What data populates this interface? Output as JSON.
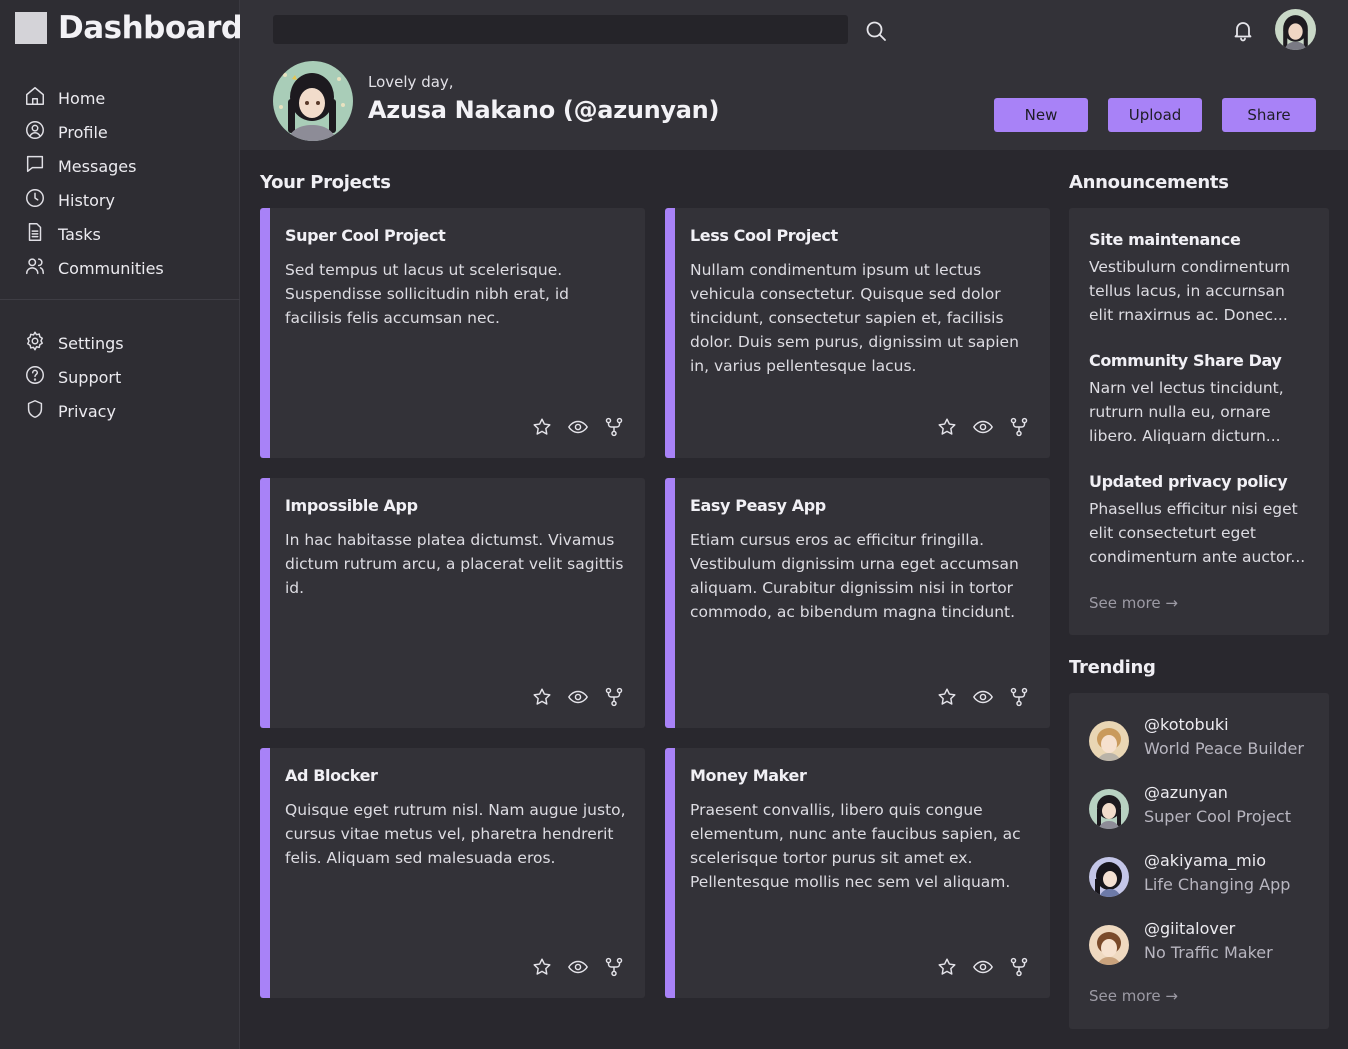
{
  "app": {
    "title": "Dashboard"
  },
  "sidebar": {
    "main": [
      {
        "label": "Home",
        "icon": "home-icon"
      },
      {
        "label": "Profile",
        "icon": "user-circle-icon"
      },
      {
        "label": "Messages",
        "icon": "chat-icon"
      },
      {
        "label": "History",
        "icon": "clock-icon"
      },
      {
        "label": "Tasks",
        "icon": "document-icon"
      },
      {
        "label": "Communities",
        "icon": "users-icon"
      }
    ],
    "secondary": [
      {
        "label": "Settings",
        "icon": "gear-icon"
      },
      {
        "label": "Support",
        "icon": "help-icon"
      },
      {
        "label": "Privacy",
        "icon": "shield-icon"
      }
    ]
  },
  "header": {
    "search": {
      "value": "",
      "placeholder": ""
    },
    "greeting": "Lovely day,",
    "user_name": "Azusa Nakano (@azunyan)",
    "buttons": {
      "new": "New",
      "upload": "Upload",
      "share": "Share"
    }
  },
  "projects": {
    "title": "Your Projects",
    "items": [
      {
        "title": "Super Cool Project",
        "description": "Sed tempus ut lacus ut scelerisque. Suspendisse sollicitudin nibh erat, id facilisis felis accumsan nec."
      },
      {
        "title": "Less Cool Project",
        "description": "Nullam condimentum ipsum ut lectus vehicula consectetur. Quisque sed dolor tincidunt, consectetur sapien et, facilisis dolor. Duis sem purus, dignissim ut sapien in, varius pellentesque lacus."
      },
      {
        "title": "Impossible App",
        "description": "In hac habitasse platea dictumst. Vivamus dictum rutrum arcu, a placerat velit sagittis id."
      },
      {
        "title": "Easy Peasy App",
        "description": "Etiam cursus eros ac efficitur fringilla. Vestibulum dignissim urna eget accumsan aliquam. Curabitur dignissim nisi in tortor commodo, ac bibendum magna tincidunt."
      },
      {
        "title": "Ad Blocker",
        "description": "Quisque eget rutrum nisl. Nam augue justo, cursus vitae metus vel, pharetra hendrerit felis. Aliquam sed malesuada eros."
      },
      {
        "title": "Money Maker",
        "description": "Praesent convallis, libero quis congue elementum, nunc ante faucibus sapien, ac scelerisque tortor purus sit amet ex. Pellentesque mollis nec sem vel aliquam."
      }
    ]
  },
  "announcements": {
    "title": "Announcements",
    "items": [
      {
        "title": "Site maintenance",
        "text": "Vestibulurn condirnenturn tellus lacus, in accurnsan elit rnaxirnus ac. Donec..."
      },
      {
        "title": "Community Share Day",
        "text": "Narn vel lectus tincidunt, rutrurn nulla eu, ornare libero. Aliquarn dicturn..."
      },
      {
        "title": "Updated privacy policy",
        "text": "Phasellus efficitur nisi eget elit consecteturt eget condimenturn ante auctor..."
      }
    ],
    "see_more": "See more →"
  },
  "trending": {
    "title": "Trending",
    "items": [
      {
        "handle": "@kotobuki",
        "project": "World Peace Builder"
      },
      {
        "handle": "@azunyan",
        "project": "Super Cool Project"
      },
      {
        "handle": "@akiyama_mio",
        "project": "Life Changing App"
      },
      {
        "handle": "@giitalover",
        "project": "No Traffic Maker"
      }
    ],
    "see_more": "See more →"
  },
  "colors": {
    "accent": "#a882f7",
    "background": "#29282e",
    "panel": "#333238",
    "sidebar": "#2e2d33"
  }
}
